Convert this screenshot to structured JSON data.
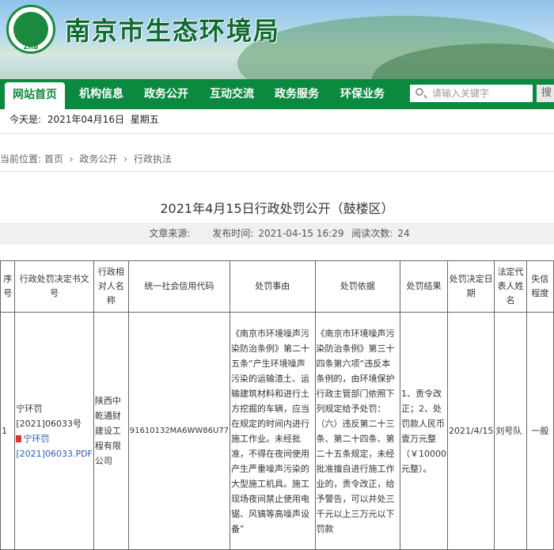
{
  "header": {
    "site_title": "南京市生态环境局",
    "logo_text": "ZHB"
  },
  "nav": {
    "items": [
      "网站首页",
      "机构信息",
      "政务公开",
      "互动交流",
      "政务服务",
      "环保业务"
    ],
    "search_placeholder": "请输入关键字",
    "search_button": "搜"
  },
  "date_bar": {
    "label": "今天是:",
    "date": "2021年04月16日",
    "weekday": "星期五"
  },
  "breadcrumb": {
    "prefix": "当前位置:",
    "items": [
      "首页",
      "政务公开",
      "行政执法"
    ],
    "separator": "›"
  },
  "article": {
    "title": "2021年4月15日行政处罚公开（鼓楼区）",
    "source_label": "文章来源:",
    "source_value": "",
    "publish_label": "发布时间:",
    "publish_time": "2021-04-15 16:29",
    "views_label": "阅读次数:",
    "views": "24"
  },
  "table": {
    "headers": [
      "序号",
      "行政处罚决定书文号",
      "行政相对人名称",
      "统一社会信用代码",
      "处罚事由",
      "处罚依据",
      "处罚结果",
      "处罚决定日期",
      "法定代表人姓名",
      "失信程度"
    ],
    "row": {
      "index": "1",
      "doc_no_line1": "宁环罚",
      "doc_no_line2": "[2021]06033号",
      "doc_link": "宁环罚[2021]06033.PDF",
      "party": "陕西中乾通财建设工程有限公司",
      "credit_code": "91610132MA6WW86U77",
      "reason": "《南京市环境噪声污染防治条例》第二十五条“产生环境噪声污染的运输渣土、运输建筑材料和进行土方挖掘的车辆，应当在规定的时间内进行施工作业。未经批准，不得在夜间使用产生严重噪声污染的大型施工机具。施工现场夜间禁止使用电锯、风镐等高噪声设备”",
      "basis": "《南京市环境噪声污染防治条例》第三十四条第六项“违反本条例的，由环境保护行政主管部门依照下列规定给予处罚：（六）违反第二十三条、第二十四条、第二十五条规定，未经批准擅自进行施工作业的，责令改正，给予警告，可以并处三千元以上三万元以下罚款",
      "result": "1、责令改正；2、处罚款人民币壹万元整（￥10000元整）。",
      "date": "2021/4/15",
      "legal_rep": "刘号队",
      "credit_level": "一般"
    }
  }
}
